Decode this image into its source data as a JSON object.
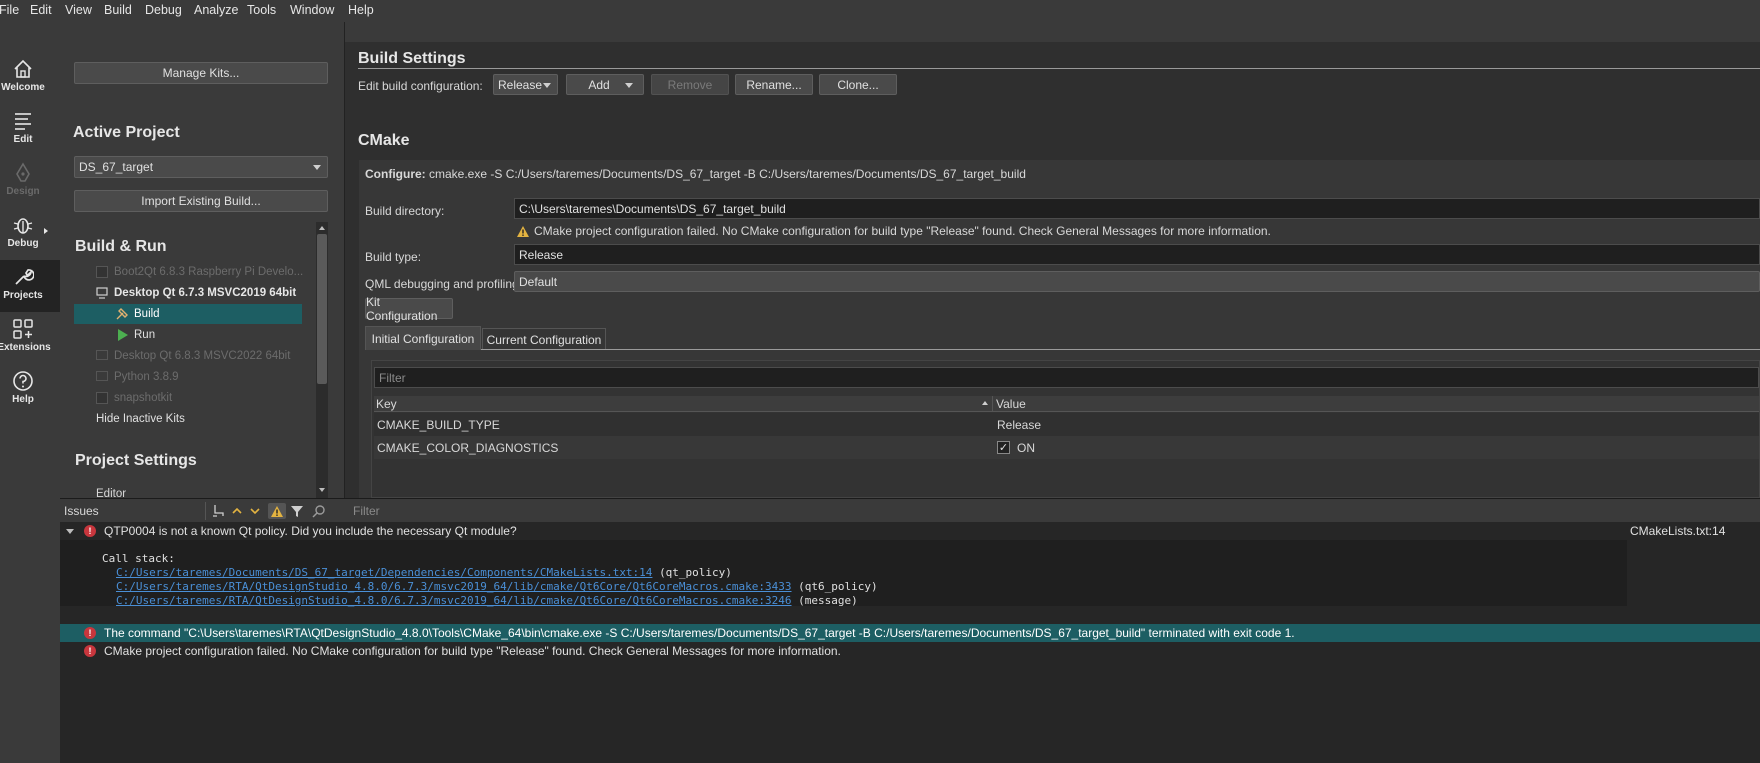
{
  "menu": [
    "File",
    "Edit",
    "View",
    "Build",
    "Debug",
    "Analyze",
    "Tools",
    "Window",
    "Help"
  ],
  "modes": [
    {
      "label": "Welcome",
      "icon": "home-icon",
      "state": "normal"
    },
    {
      "label": "Edit",
      "icon": "edit-lines-icon",
      "state": "normal"
    },
    {
      "label": "Design",
      "icon": "pen-icon",
      "state": "disabled"
    },
    {
      "label": "Debug",
      "icon": "bug-icon",
      "state": "normal"
    },
    {
      "label": "Projects",
      "icon": "wrench-icon",
      "state": "active"
    },
    {
      "label": "Extensions",
      "icon": "extensions-grid-icon",
      "state": "normal"
    },
    {
      "label": "Help",
      "icon": "help-circle-icon",
      "state": "normal"
    }
  ],
  "left": {
    "manage_kits": "Manage Kits...",
    "active_project_title": "Active Project",
    "project_selected": "DS_67_target",
    "import_build": "Import Existing Build...",
    "build_run_title": "Build & Run",
    "kits": [
      {
        "label": "Boot2Qt 6.8.3 Raspberry Pi Develo...",
        "state": "inactive"
      },
      {
        "label": "Desktop Qt 6.7.3 MSVC2019 64bit",
        "state": "active"
      },
      {
        "label": "Build",
        "state": "selected"
      },
      {
        "label": "Run",
        "state": "child"
      },
      {
        "label": "Desktop Qt 6.8.3 MSVC2022 64bit",
        "state": "inactive"
      },
      {
        "label": "Python 3.8.9",
        "state": "inactive"
      },
      {
        "label": "snapshotkit",
        "state": "inactive"
      }
    ],
    "hide_inactive": "Hide Inactive Kits",
    "project_settings_title": "Project Settings",
    "editor_item": "Editor"
  },
  "build_settings": {
    "title": "Build Settings",
    "edit_config_label": "Edit build configuration:",
    "config_selected": "Release",
    "add": "Add",
    "remove": "Remove",
    "rename": "Rename...",
    "clone": "Clone..."
  },
  "cmake": {
    "title": "CMake",
    "configure_label": "Configure:",
    "configure_cmd": "cmake.exe -S C:/Users/taremes/Documents/DS_67_target -B C:/Users/taremes/Documents/DS_67_target_build",
    "build_dir_label": "Build directory:",
    "build_dir_value": "C:\\Users\\taremes\\Documents\\DS_67_target_build",
    "warning": "CMake project configuration failed. No CMake configuration for build type \"Release\" found. Check General Messages for more information.",
    "build_type_label": "Build type:",
    "build_type_value": "Release",
    "qml_label": "QML debugging and profiling:",
    "qml_value": "Default",
    "kit_config": "Kit Configuration",
    "tabs": [
      "Initial Configuration",
      "Current Configuration"
    ],
    "filter_placeholder": "Filter",
    "columns": [
      "Key",
      "Value"
    ],
    "rows": [
      {
        "key": "CMAKE_BUILD_TYPE",
        "value": "Release",
        "checkbox": false
      },
      {
        "key": "CMAKE_COLOR_DIAGNOSTICS",
        "value": "ON",
        "checkbox": true
      }
    ]
  },
  "issues": {
    "title": "Issues",
    "filter_placeholder": "Filter",
    "first_message": "QTP0004 is not a known Qt policy.  Did you include the necessary Qt module?",
    "first_location": "CMakeLists.txt:14",
    "call_stack_label": "Call stack:",
    "stack": [
      {
        "path": "C:/Users/taremes/Documents/DS_67_target/Dependencies/Components/CMakeLists.txt:14",
        "fn": "(qt_policy)"
      },
      {
        "path": "C:/Users/taremes/RTA/QtDesignStudio_4.8.0/6.7.3/msvc2019_64/lib/cmake/Qt6Core/Qt6CoreMacros.cmake:3433",
        "fn": "(qt6_policy)"
      },
      {
        "path": "C:/Users/taremes/RTA/QtDesignStudio_4.8.0/6.7.3/msvc2019_64/lib/cmake/Qt6Core/Qt6CoreMacros.cmake:3246",
        "fn": "(message)"
      }
    ],
    "second_message": "The command \"C:\\Users\\taremes\\RTA\\QtDesignStudio_4.8.0\\Tools\\CMake_64\\bin\\cmake.exe -S C:/Users/taremes/Documents/DS_67_target -B C:/Users/taremes/Documents/DS_67_target_build\" terminated with exit code 1.",
    "third_message": "CMake project configuration failed. No CMake configuration for build type \"Release\" found. Check General Messages for more information."
  },
  "colors": {
    "accent": "#1d5e63",
    "error": "#c8363d",
    "warning": "#e3b341",
    "link": "#4a8fd6"
  }
}
